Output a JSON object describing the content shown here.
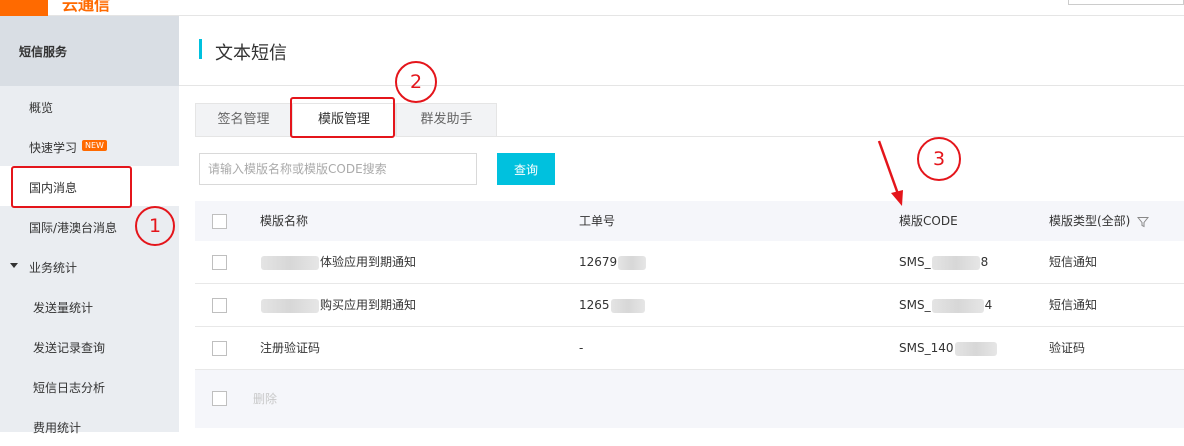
{
  "brand": {
    "logo_text": "云通信"
  },
  "sidebar": {
    "header": "短信服务",
    "items": [
      {
        "label": "概览"
      },
      {
        "label": "快速学习",
        "badge": "NEW"
      },
      {
        "label": "国内消息"
      },
      {
        "label": "国际/港澳台消息"
      },
      {
        "label": "业务统计"
      },
      {
        "label": "发送量统计"
      },
      {
        "label": "发送记录查询"
      },
      {
        "label": "短信日志分析"
      },
      {
        "label": "费用统计"
      }
    ]
  },
  "main": {
    "title": "文本短信",
    "tabs": [
      {
        "label": "签名管理"
      },
      {
        "label": "模版管理"
      },
      {
        "label": "群发助手"
      }
    ],
    "search": {
      "placeholder": "请输入模版名称或模版CODE搜索",
      "value": ""
    },
    "query_label": "查询",
    "table": {
      "columns": [
        "模版名称",
        "工单号",
        "模版CODE",
        "模版类型(全部)"
      ],
      "rows": [
        {
          "name_suffix": "体验应用到期通知",
          "ticket_prefix": "12679",
          "code_prefix": "SMS_",
          "code_suffix": "8",
          "type": "短信通知"
        },
        {
          "name_suffix": "购买应用到期通知",
          "ticket_prefix": "1265",
          "code_prefix": "SMS_",
          "code_suffix": "4",
          "type": "短信通知"
        },
        {
          "name": "注册验证码",
          "ticket": "-",
          "code_prefix": "SMS_140",
          "code_suffix": "",
          "type": "验证码"
        }
      ],
      "delete_label": "删除"
    }
  },
  "annotations": {
    "n1": "1",
    "n2": "2",
    "n3": "3"
  },
  "colors": {
    "accent": "#00c1de",
    "brand": "#ff6a00",
    "annotation": "#e4151b"
  },
  "icons": {
    "filter": "filter-icon",
    "sort_caret": "caret-down-icon"
  }
}
